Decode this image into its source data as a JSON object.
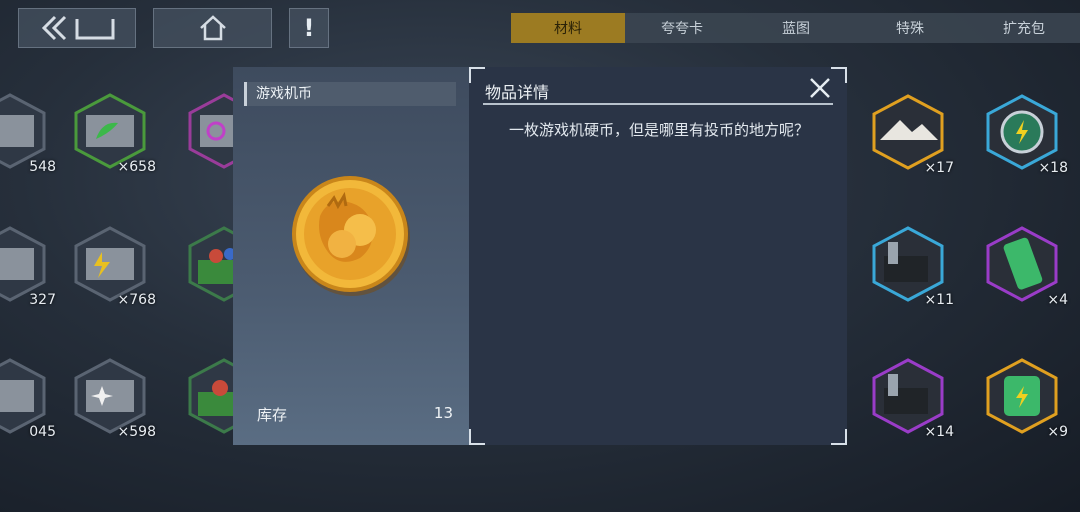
{
  "top_nav": {
    "back_icon": "double-chevron-left-icon",
    "home_icon": "home-icon",
    "alert_icon": "exclamation-icon",
    "alert_glyph": "!"
  },
  "tabs": [
    {
      "label": "材料",
      "active": true
    },
    {
      "label": "夸夸卡",
      "active": false
    },
    {
      "label": "蓝图",
      "active": false
    },
    {
      "label": "特殊",
      "active": false
    },
    {
      "label": "扩充包",
      "active": false
    }
  ],
  "inventory_left": [
    {
      "count": "548",
      "icon": "crate-icon",
      "border": "#5a6472"
    },
    {
      "count": "×658",
      "icon": "crate-green-leaf-icon",
      "border": "#4a9a3c"
    },
    {
      "count": "",
      "icon": "crate-purple-swirl-icon",
      "border": "#9a3c9a"
    },
    {
      "count": "327",
      "icon": "crate-icon",
      "border": "#5a6472"
    },
    {
      "count": "×768",
      "icon": "crate-lightning-icon",
      "border": "#5a6472"
    },
    {
      "count": "",
      "icon": "green-bin-icon",
      "border": "#3c7a4a"
    },
    {
      "count": "045",
      "icon": "crate-icon",
      "border": "#5a6472"
    },
    {
      "count": "×598",
      "icon": "crate-star-icon",
      "border": "#5a6472"
    },
    {
      "count": "",
      "icon": "green-bin-red-icon",
      "border": "#3c7a4a"
    }
  ],
  "inventory_right": [
    {
      "count": "×17",
      "icon": "snow-mountain-icon",
      "border": "#e0a020"
    },
    {
      "count": "×18",
      "icon": "energy-coin-icon",
      "border": "#3aa8d8"
    },
    {
      "count": "×11",
      "icon": "machine-part-icon",
      "border": "#3aa8d8"
    },
    {
      "count": "×4",
      "icon": "green-battery-icon",
      "border": "#9a3cc8"
    },
    {
      "count": "×14",
      "icon": "machine-part-purple-icon",
      "border": "#9a3cc8"
    },
    {
      "count": "×9",
      "icon": "green-battery-gold-icon",
      "border": "#e0a020"
    }
  ],
  "item": {
    "name": "游戏机币",
    "icon": "arcade-coin-icon",
    "stock_label": "库存",
    "stock_value": "13"
  },
  "detail": {
    "title": "物品详情",
    "description": "一枚游戏机硬币，但是哪里有投币的地方呢？",
    "close_icon": "close-icon"
  },
  "colors": {
    "active_tab": "#9c7b22",
    "panel_left": "#4c5c71",
    "panel_right": "#2a3446",
    "coin_gold": "#e8a82a"
  }
}
